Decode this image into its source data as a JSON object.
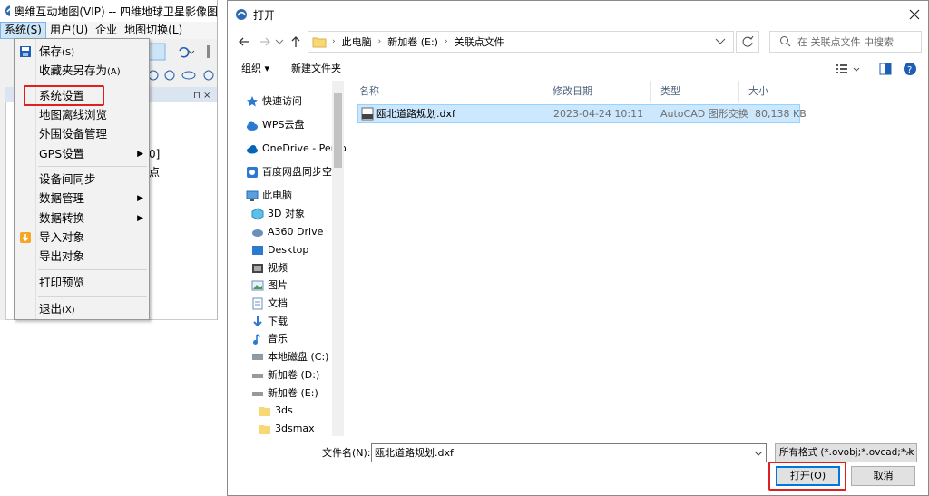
{
  "app": {
    "title": "奥维互动地图(VIP) -- 四维地球卫星影像图",
    "menus": [
      "系统(S)",
      "用户(U)",
      "企业",
      "地图切换(L)"
    ],
    "panel_text": [
      "0]",
      "点"
    ],
    "system_menu": {
      "items": [
        {
          "label": "保存",
          "hotkey": "(S)",
          "icon": "save-icon"
        },
        {
          "label": "收藏夹另存为",
          "hotkey": "(A)"
        },
        {
          "label": "系统设置",
          "hotkey": ""
        },
        {
          "label": "地图离线浏览",
          "hotkey": ""
        },
        {
          "label": "外围设备管理",
          "hotkey": ""
        },
        {
          "label": "GPS设置",
          "hotkey": "",
          "submenu": true
        },
        {
          "label": "设备间同步",
          "hotkey": ""
        },
        {
          "label": "数据管理",
          "hotkey": "",
          "submenu": true
        },
        {
          "label": "数据转换",
          "hotkey": "",
          "submenu": true
        },
        {
          "label": "导入对象",
          "hotkey": "",
          "icon": "import-icon"
        },
        {
          "label": "导出对象",
          "hotkey": ""
        },
        {
          "label": "打印预览",
          "hotkey": ""
        },
        {
          "label": "退出",
          "hotkey": "(X)"
        }
      ]
    }
  },
  "dialog": {
    "title": "打开",
    "breadcrumb": [
      "此电脑",
      "新加卷 (E:)",
      "关联点文件"
    ],
    "search_placeholder": "在 关联点文件 中搜索",
    "organize": "组织 ▾",
    "new_folder": "新建文件夹",
    "tree": [
      {
        "label": "快速访问",
        "icon": "star-icon"
      },
      {
        "label": "WPS云盘",
        "icon": "cloud-icon"
      },
      {
        "label": "OneDrive - Perso",
        "icon": "onedrive-icon"
      },
      {
        "label": "百度网盘同步空间",
        "icon": "baidu-icon"
      },
      {
        "label": "此电脑",
        "icon": "computer-icon"
      },
      {
        "label": "3D 对象",
        "icon": "cube-icon"
      },
      {
        "label": "A360 Drive",
        "icon": "a360-icon"
      },
      {
        "label": "Desktop",
        "icon": "desktop-icon"
      },
      {
        "label": "视频",
        "icon": "video-icon"
      },
      {
        "label": "图片",
        "icon": "picture-icon"
      },
      {
        "label": "文档",
        "icon": "document-icon"
      },
      {
        "label": "下载",
        "icon": "download-icon"
      },
      {
        "label": "音乐",
        "icon": "music-icon"
      },
      {
        "label": "本地磁盘 (C:)",
        "icon": "drive-icon"
      },
      {
        "label": "新加卷 (D:)",
        "icon": "drive-icon"
      },
      {
        "label": "新加卷 (E:)",
        "icon": "drive-icon"
      },
      {
        "label": "3ds",
        "icon": "folder-icon"
      },
      {
        "label": "3dsmax",
        "icon": "folder-icon"
      }
    ],
    "columns": [
      "名称",
      "修改日期",
      "类型",
      "大小"
    ],
    "files": [
      {
        "name": "瓯北道路规划.dxf",
        "date": "2023-04-24 10:11",
        "type": "AutoCAD 图形交换",
        "size": "80,138 KB",
        "selected": true
      }
    ],
    "filename_label": "文件名(N):",
    "filename_value": "瓯北道路规划.dxf",
    "filetype": "所有格式 (*.ovobj;*.ovcad;*.k",
    "open_label": "打开(O)",
    "cancel_label": "取消"
  },
  "colors": {
    "highlight_box": "#e02020",
    "selection": "#cce8ff",
    "accent": "#0078d7"
  }
}
